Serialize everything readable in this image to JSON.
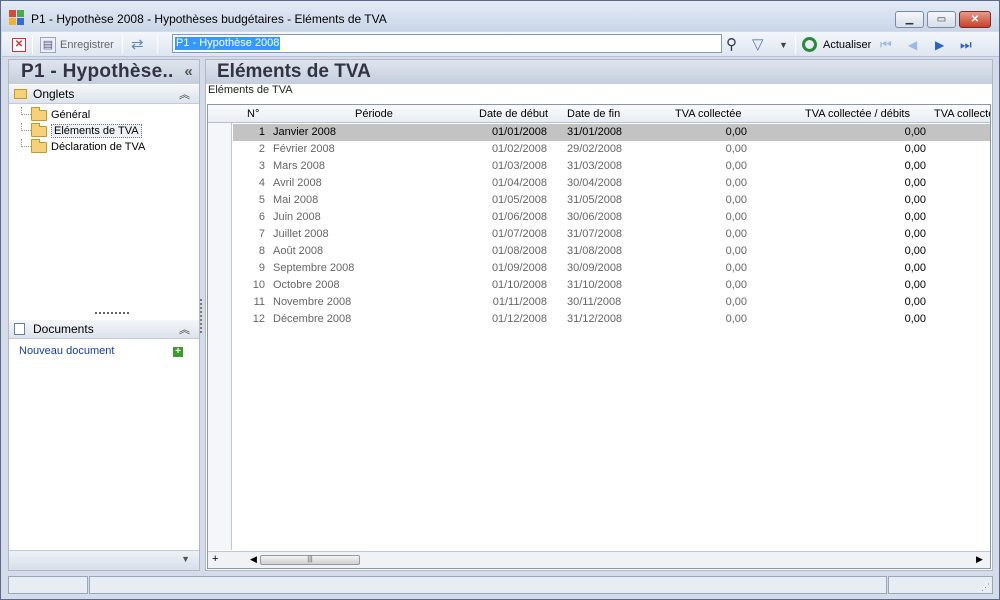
{
  "window": {
    "title": "P1 - Hypothèse 2008 -  Hypothèses budgétaires - Eléments de TVA"
  },
  "toolbar": {
    "save_label": "Enregistrer",
    "search_value": "P1 - Hypothèse 2008",
    "refresh_label": "Actualiser"
  },
  "left_panel": {
    "title": "P1 - Hypothèse..",
    "onglets_label": "Onglets",
    "tree_items": [
      "Général",
      "Eléments de TVA",
      "Déclaration de TVA"
    ],
    "documents_label": "Documents",
    "new_document_label": "Nouveau document"
  },
  "main": {
    "title": "Eléments de TVA",
    "subtitle": "Eléments de TVA",
    "columns": [
      "N°",
      "Période",
      "Date de début",
      "Date de fin",
      "TVA collectée",
      "TVA collectée / débits",
      "TVA collecté"
    ],
    "rows": [
      {
        "n": "1",
        "periode": "Janvier 2008",
        "debut": "01/01/2008",
        "fin": "31/01/2008",
        "tva": "0,00",
        "tva_debits": "0,00"
      },
      {
        "n": "2",
        "periode": "Février 2008",
        "debut": "01/02/2008",
        "fin": "29/02/2008",
        "tva": "0,00",
        "tva_debits": "0,00"
      },
      {
        "n": "3",
        "periode": "Mars 2008",
        "debut": "01/03/2008",
        "fin": "31/03/2008",
        "tva": "0,00",
        "tva_debits": "0,00"
      },
      {
        "n": "4",
        "periode": "Avril 2008",
        "debut": "01/04/2008",
        "fin": "30/04/2008",
        "tva": "0,00",
        "tva_debits": "0,00"
      },
      {
        "n": "5",
        "periode": "Mai 2008",
        "debut": "01/05/2008",
        "fin": "31/05/2008",
        "tva": "0,00",
        "tva_debits": "0,00"
      },
      {
        "n": "6",
        "periode": "Juin 2008",
        "debut": "01/06/2008",
        "fin": "30/06/2008",
        "tva": "0,00",
        "tva_debits": "0,00"
      },
      {
        "n": "7",
        "periode": "Juillet 2008",
        "debut": "01/07/2008",
        "fin": "31/07/2008",
        "tva": "0,00",
        "tva_debits": "0,00"
      },
      {
        "n": "8",
        "periode": "Août 2008",
        "debut": "01/08/2008",
        "fin": "31/08/2008",
        "tva": "0,00",
        "tva_debits": "0,00"
      },
      {
        "n": "9",
        "periode": "Septembre 2008",
        "debut": "01/09/2008",
        "fin": "30/09/2008",
        "tva": "0,00",
        "tva_debits": "0,00"
      },
      {
        "n": "10",
        "periode": "Octobre 2008",
        "debut": "01/10/2008",
        "fin": "31/10/2008",
        "tva": "0,00",
        "tva_debits": "0,00"
      },
      {
        "n": "11",
        "periode": "Novembre 2008",
        "debut": "01/11/2008",
        "fin": "30/11/2008",
        "tva": "0,00",
        "tva_debits": "0,00"
      },
      {
        "n": "12",
        "periode": "Décembre 2008",
        "debut": "01/12/2008",
        "fin": "31/12/2008",
        "tva": "0,00",
        "tva_debits": "0,00"
      }
    ]
  },
  "colors": {
    "selected_row": "#c3c3c3",
    "link": "#1a3c9c",
    "nav_arrow": "#2a63c7"
  }
}
